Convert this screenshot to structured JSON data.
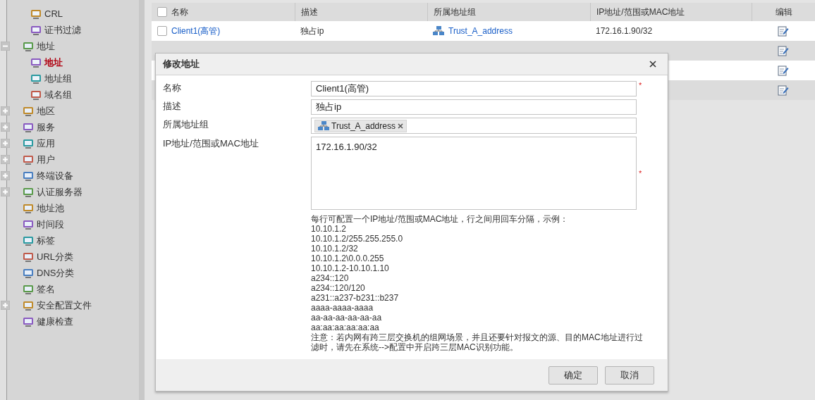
{
  "sidebar": {
    "items": [
      {
        "children": [
          {
            "label": "CRL",
            "selected": false
          },
          {
            "label": "证书过滤",
            "selected": false
          }
        ]
      },
      {
        "label": "地址",
        "expanded": true,
        "selected": false,
        "children": [
          {
            "label": "地址",
            "selected": true
          },
          {
            "label": "地址组",
            "selected": false
          },
          {
            "label": "域名组",
            "selected": false
          }
        ]
      },
      {
        "label": "地区",
        "expanded": false,
        "selected": false
      },
      {
        "label": "服务",
        "expanded": false,
        "selected": false
      },
      {
        "label": "应用",
        "expanded": false,
        "selected": false
      },
      {
        "label": "用户",
        "expanded": false,
        "selected": false
      },
      {
        "label": "终端设备",
        "expanded": false,
        "selected": false
      },
      {
        "label": "认证服务器",
        "expanded": false,
        "selected": false
      },
      {
        "label": "地址池",
        "selected": false
      },
      {
        "label": "时间段",
        "selected": false
      },
      {
        "label": "标签",
        "selected": false
      },
      {
        "label": "URL分类",
        "selected": false
      },
      {
        "label": "DNS分类",
        "selected": false
      },
      {
        "label": "签名",
        "selected": false
      },
      {
        "label": "安全配置文件",
        "expanded": false,
        "selected": false
      },
      {
        "label": "健康检查",
        "selected": false
      }
    ]
  },
  "table": {
    "select_all_checked": false,
    "columns": [
      "名称",
      "描述",
      "所属地址组",
      "IP地址/范围或MAC地址",
      "编辑"
    ],
    "rows": [
      {
        "checked": false,
        "name": "Client1(高管)",
        "description": "独占ip",
        "group": "Trust_A_address",
        "address": "172.16.1.90/32"
      },
      {},
      {},
      {}
    ]
  },
  "dialog": {
    "title": "修改地址",
    "fields": [
      {
        "kind": "input",
        "label": "名称",
        "value": "Client1(高管)",
        "required_mark": "*"
      },
      {
        "kind": "input",
        "label": "描述",
        "value": "独占ip"
      },
      {
        "kind": "tags",
        "label": "所属地址组",
        "tags": [
          "Trust_A_address"
        ]
      },
      {
        "kind": "textarea",
        "label": "IP地址/范围或MAC地址",
        "value": "172.16.1.90/32",
        "required_mark": "*"
      }
    ],
    "help_lines": [
      "每行可配置一个IP地址/范围或MAC地址，行之间用回车分隔，示例：",
      "10.10.1.2",
      "10.10.1.2/255.255.255.0",
      "10.10.1.2/32",
      "10.10.1.2\\0.0.0.255",
      "10.10.1.2-10.10.1.10",
      "a234::120",
      "a234::120/120",
      "a231::a237-b231::b237",
      "aaaa-aaaa-aaaa",
      "aa-aa-aa-aa-aa-aa",
      "aa:aa:aa:aa:aa:aa"
    ],
    "note": "注意：若内网有跨三层交换机的组网场景，并且还要针对报文的源、目的MAC地址进行过滤时，请先在系统-->配置中开启跨三层MAC识别功能。",
    "buttons": [
      "确定",
      "取消"
    ]
  }
}
